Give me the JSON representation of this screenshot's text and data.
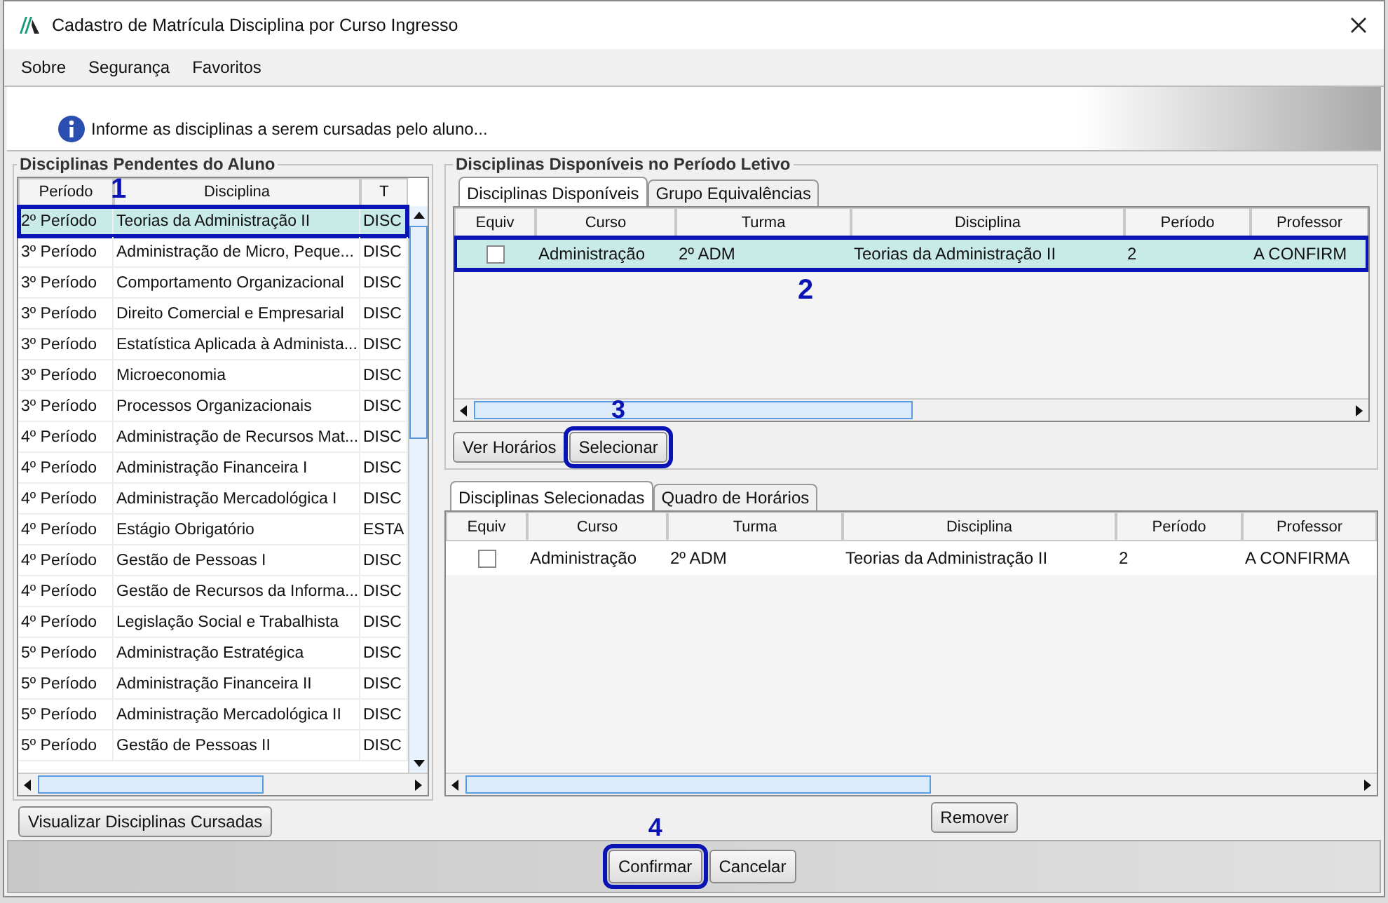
{
  "window": {
    "title": "Cadastro de Matrícula Disciplina por Curso Ingresso"
  },
  "menu": [
    {
      "label": "Sobre"
    },
    {
      "label": "Segurança"
    },
    {
      "label": "Favoritos"
    }
  ],
  "info": {
    "text": "Informe as disciplinas a serem cursadas pelo aluno..."
  },
  "pending": {
    "title": "Disciplinas Pendentes do Aluno",
    "columns": [
      "Período",
      "Disciplina",
      "T"
    ],
    "rows": [
      {
        "periodo": "2º Período",
        "disciplina": "Teorias da Administração II",
        "tipo": "DISC",
        "selected": true,
        "callout": "1"
      },
      {
        "periodo": "3º Período",
        "disciplina": "Administração de Micro, Peque...",
        "tipo": "DISC",
        "selected": false
      },
      {
        "periodo": "3º Período",
        "disciplina": "Comportamento Organizacional",
        "tipo": "DISC",
        "selected": false
      },
      {
        "periodo": "3º Período",
        "disciplina": "Direito Comercial e Empresarial",
        "tipo": "DISC",
        "selected": false
      },
      {
        "periodo": "3º Período",
        "disciplina": "Estatística Aplicada à Administa...",
        "tipo": "DISC",
        "selected": false
      },
      {
        "periodo": "3º Período",
        "disciplina": "Microeconomia",
        "tipo": "DISC",
        "selected": false
      },
      {
        "periodo": "3º Período",
        "disciplina": "Processos Organizacionais",
        "tipo": "DISC",
        "selected": false
      },
      {
        "periodo": "4º Período",
        "disciplina": "Administração de Recursos Mat...",
        "tipo": "DISC",
        "selected": false
      },
      {
        "periodo": "4º Período",
        "disciplina": "Administração Financeira I",
        "tipo": "DISC",
        "selected": false
      },
      {
        "periodo": "4º Período",
        "disciplina": "Administração Mercadológica I",
        "tipo": "DISC",
        "selected": false
      },
      {
        "periodo": "4º Período",
        "disciplina": "Estágio Obrigatório",
        "tipo": "ESTA",
        "selected": false
      },
      {
        "periodo": "4º Período",
        "disciplina": "Gestão de Pessoas I",
        "tipo": "DISC",
        "selected": false
      },
      {
        "periodo": "4º Período",
        "disciplina": "Gestão de Recursos da Informa...",
        "tipo": "DISC",
        "selected": false
      },
      {
        "periodo": "4º Período",
        "disciplina": "Legislação Social e Trabalhista",
        "tipo": "DISC",
        "selected": false
      },
      {
        "periodo": "5º Período",
        "disciplina": "Administração Estratégica",
        "tipo": "DISC",
        "selected": false
      },
      {
        "periodo": "5º Período",
        "disciplina": "Administração Financeira II",
        "tipo": "DISC",
        "selected": false
      },
      {
        "periodo": "5º Período",
        "disciplina": "Administração Mercadológica II",
        "tipo": "DISC",
        "selected": false
      },
      {
        "periodo": "5º Período",
        "disciplina": "Gestão de Pessoas II",
        "tipo": "DISC",
        "selected": false
      }
    ],
    "button": "Visualizar Disciplinas Cursadas"
  },
  "available": {
    "title": "Disciplinas Disponíveis no Período Letivo",
    "tabs": [
      {
        "label": "Disciplinas Disponíveis",
        "selected": true
      },
      {
        "label": "Grupo Equivalências",
        "selected": false
      }
    ],
    "columns": [
      "Equiv",
      "Curso",
      "Turma",
      "Disciplina",
      "Período",
      "Professor"
    ],
    "rows": [
      {
        "equiv": false,
        "curso": "Administração",
        "turma": "2º ADM",
        "disciplina": "Teorias da Administração II",
        "periodo": "2",
        "professor": "A CONFIRM",
        "selected": true,
        "callout": "2"
      }
    ],
    "buttons": [
      {
        "label": "Ver Horários"
      },
      {
        "label": "Selecionar",
        "callout": "3"
      }
    ]
  },
  "chosen": {
    "tabs": [
      {
        "label": "Disciplinas Selecionadas",
        "selected": true
      },
      {
        "label": "Quadro de Horários",
        "selected": false
      }
    ],
    "columns": [
      "Equiv",
      "Curso",
      "Turma",
      "Disciplina",
      "Período",
      "Professor"
    ],
    "rows": [
      {
        "equiv": false,
        "curso": "Administração",
        "turma": "2º ADM",
        "disciplina": "Teorias da Administração II",
        "periodo": "2",
        "professor": "A CONFIRMA",
        "selected": false
      }
    ],
    "button": "Remover"
  },
  "footer": {
    "buttons": [
      {
        "label": "Confirmar",
        "callout": "4"
      },
      {
        "label": "Cancelar"
      }
    ]
  }
}
